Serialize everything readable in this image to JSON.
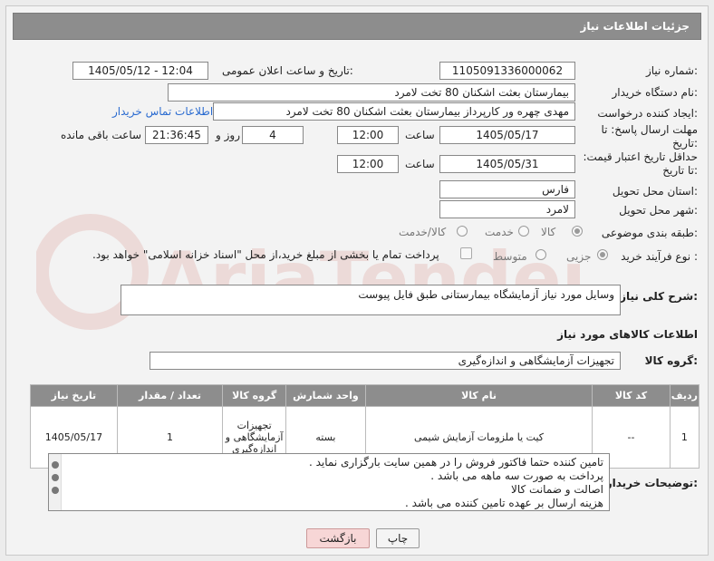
{
  "header": {
    "title": "جزئیات اطلاعات نیاز"
  },
  "fields": {
    "need_number_label": "شماره نیاز:",
    "need_number": "1105091336000062",
    "announce_label": "تاریخ و ساعت اعلان عمومی:",
    "announce_value": "1405/05/12 - 12:04",
    "buyer_org_label": "نام دستگاه خریدار:",
    "buyer_org": "بیمارستان بعثت اشکنان 80 تخت لامرد",
    "creator_label": "ایجاد کننده درخواست:",
    "creator": "مهدی چهره ور کارپرداز بیمارستان بعثت اشکنان 80 تخت لامرد",
    "contact_link": "اطلاعات تماس خریدار",
    "deadline_label": "مهلت ارسال پاسخ: تا تاریخ:",
    "deadline_date": "1405/05/17",
    "time_label": "ساعت",
    "deadline_time": "12:00",
    "days_value": "4",
    "days_label": "روز و",
    "remaining_time": "21:36:45",
    "remaining_label": "ساعت باقی مانده",
    "validity_label": "حداقل تاریخ اعتبار قیمت: تا تاریخ:",
    "validity_date": "1405/05/31",
    "validity_time": "12:00",
    "province_label": "استان محل تحویل:",
    "province": "فارس",
    "city_label": "شهر محل تحویل:",
    "city": "لامرد",
    "category_label": "طبقه بندی موضوعی:",
    "category_options": [
      "کالا",
      "خدمت",
      "کالا/خدمت"
    ],
    "process_label": "نوع فرآیند خرید :",
    "process_options": [
      "جزیی",
      "متوسط"
    ],
    "payment_note": "پرداخت تمام یا بخشی از مبلغ خرید،از محل \"اسناد خزانه اسلامی\" خواهد بود."
  },
  "description": {
    "label": "شرح کلی نیاز:",
    "value": "وسایل مورد نیاز آزمایشگاه بیمارستانی طبق فایل پیوست"
  },
  "goods_section": {
    "title": "اطلاعات کالاهای مورد نیاز",
    "group_label": "گروه کالا:",
    "group_value": "تجهیزات آزمایشگاهی و اندازه‌گیری"
  },
  "table": {
    "headers": [
      "ردیف",
      "کد کالا",
      "نام کالا",
      "واحد شمارش",
      "گروه کالا",
      "تعداد / مقدار",
      "تاریخ نیاز"
    ],
    "rows": [
      [
        "1",
        "--",
        "کیت یا ملزومات آزمایش شیمی",
        "بسته",
        "تجهیزات آزمایشگاهی و اندازه‌گیری",
        "1",
        "1405/05/17"
      ]
    ]
  },
  "buyer_notes": {
    "label": "توضیحات خریدار:",
    "lines": [
      "تامین کننده حتما فاکتور فروش را در همین سایت بارگزاری نماید .",
      "پرداخت به صورت سه ماهه می باشد .",
      "اصالت و ضمانت کالا",
      "هزینه ارسال بر عهده تامین کننده می باشد ."
    ]
  },
  "buttons": {
    "print": "چاپ",
    "back": "بازگشت"
  },
  "watermark": "AriaTender.net"
}
